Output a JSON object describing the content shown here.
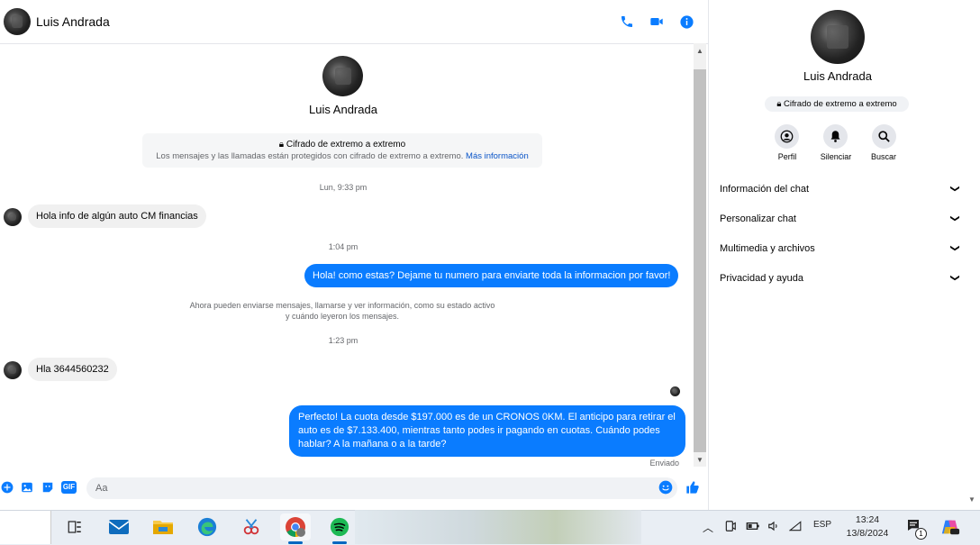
{
  "header": {
    "contact_name": "Luis Andrada"
  },
  "chat": {
    "contact_name": "Luis Andrada",
    "encryption_title": "Cifrado de extremo a extremo",
    "encryption_text": "Los mensajes y las llamadas están protegidos con cifrado de extremo a extremo.",
    "encryption_link": "Más información",
    "messages": [
      {
        "type": "timestamp",
        "text": "Lun, 9:33 pm"
      },
      {
        "type": "incoming",
        "text": "Hola info de algún auto CM financias"
      },
      {
        "type": "timestamp",
        "text": "1:04 pm"
      },
      {
        "type": "outgoing",
        "text": "Hola! como estas? Dejame tu numero para enviarte toda la informacion por favor!"
      },
      {
        "type": "system",
        "text": "Ahora pueden enviarse mensajes, llamarse y ver información, como su estado activo y cuándo leyeron los mensajes."
      },
      {
        "type": "timestamp",
        "text": "1:23 pm"
      },
      {
        "type": "incoming",
        "text": "Hla 3644560232"
      },
      {
        "type": "outgoing",
        "text": "Perfecto! La cuota desde $197.000 es de un CRONOS 0KM. El anticipo para retirar el auto es de $7.133.400, mientras tanto podes ir pagando en cuotas. Cuándo podes hablar? A la mañana o a la tarde?"
      }
    ],
    "status": "Enviado"
  },
  "composer": {
    "placeholder": "Aa",
    "gif_label": "GIF"
  },
  "panel": {
    "contact_name": "Luis Andrada",
    "encryption_badge": "Cifrado de extremo a extremo",
    "actions": [
      {
        "label": "Perfil",
        "icon": "profile-icon"
      },
      {
        "label": "Silenciar",
        "icon": "bell-icon"
      },
      {
        "label": "Buscar",
        "icon": "search-icon"
      }
    ],
    "sections": [
      "Información del chat",
      "Personalizar chat",
      "Multimedia y archivos",
      "Privacidad y ayuda"
    ]
  },
  "taskbar": {
    "language": "ESP",
    "time": "13:24",
    "date": "13/8/2024",
    "notification_count": "1",
    "accent": "#0067c0"
  },
  "colors": {
    "messenger_blue": "#0a7cff",
    "incoming_bubble": "#f0f0f0"
  }
}
